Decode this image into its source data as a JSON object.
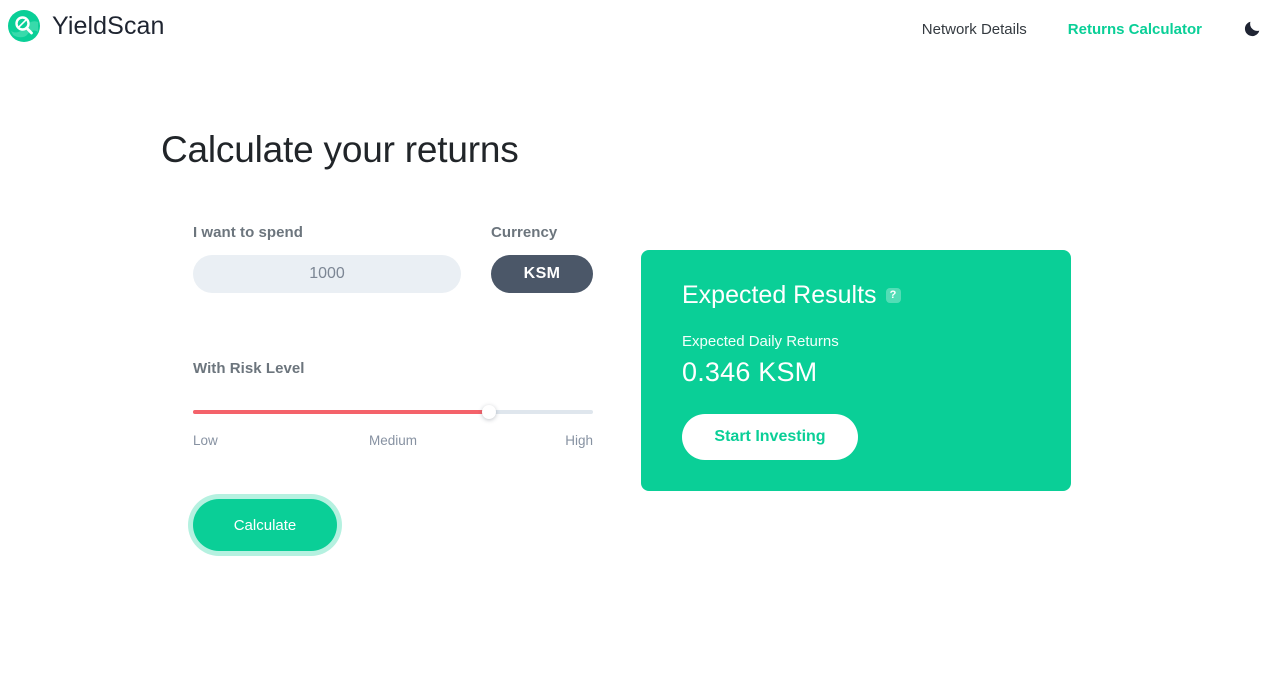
{
  "header": {
    "brand_name": "YieldScan",
    "logo_icon": "yieldscan-magnifier-logo",
    "nav": [
      {
        "label": "Network Details",
        "active": false
      },
      {
        "label": "Returns Calculator",
        "active": true
      }
    ],
    "theme_toggle_icon": "moon-icon"
  },
  "main": {
    "page_title": "Calculate your returns",
    "form": {
      "spend_label": "I want to spend",
      "spend_value": "1000",
      "spend_placeholder": "1000",
      "currency_label": "Currency",
      "currency_value": "KSM",
      "risk_label": "With Risk Level",
      "risk_scale": {
        "low": "Low",
        "medium": "Medium",
        "high": "High"
      },
      "risk_fill_percent": 74,
      "calculate_label": "Calculate"
    },
    "results": {
      "title": "Expected Results",
      "help_icon_glyph": "?",
      "daily_returns_label": "Expected Daily Returns",
      "daily_returns_value": "0.346 KSM",
      "cta_label": "Start Investing"
    }
  },
  "colors": {
    "accent_green": "#0ACF97",
    "risk_red": "#f4626a",
    "currency_dark": "#4b5768",
    "input_bg": "#eaeff4",
    "label_gray": "#6c757d"
  }
}
